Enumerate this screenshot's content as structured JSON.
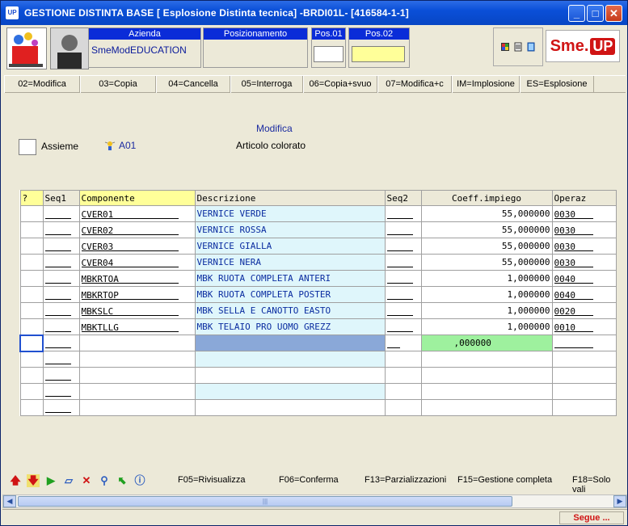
{
  "window": {
    "app_icon": "UP",
    "title": "GESTIONE DISTINTA BASE [ Esplosione Distinta tecnica] -BRDI01L- [416584-1-1]",
    "minimize_icon": "minimize-icon",
    "maximize_icon": "maximize-icon",
    "close_icon": "close-icon"
  },
  "header": {
    "azienda_label": "Azienda",
    "azienda_value": "SmeModEDUCATION",
    "posizionamento_label": "Posizionamento",
    "pos01_label": "Pos.01",
    "pos02_label": "Pos.02",
    "logo_text_1": "Sme.",
    "logo_text_2": "UP"
  },
  "function_keys": [
    {
      "label": "02=Modifica"
    },
    {
      "label": "03=Copia"
    },
    {
      "label": "04=Cancella"
    },
    {
      "label": "05=Interroga"
    },
    {
      "label": "06=Copia+svuo"
    },
    {
      "label": "07=Modifica+c"
    },
    {
      "label": "IM=Implosione"
    },
    {
      "label": "ES=Esplosione"
    }
  ],
  "form": {
    "mode": "Modifica",
    "assieme_label": "Assieme",
    "article_code": "A01",
    "article_desc": "Articolo colorato"
  },
  "grid": {
    "headers": {
      "q": "?",
      "seq1": "Seq1",
      "componente": "Componente",
      "descrizione": "Descrizione",
      "seq2": "Seq2",
      "coeff": "Coeff.impiego",
      "operaz": "Operaz"
    },
    "rows": [
      {
        "componente": "CVER01",
        "descrizione": "VERNICE VERDE",
        "coeff": "55,000000",
        "operaz": "0030"
      },
      {
        "componente": "CVER02",
        "descrizione": "VERNICE ROSSA",
        "coeff": "55,000000",
        "operaz": "0030"
      },
      {
        "componente": "CVER03",
        "descrizione": "VERNICE GIALLA",
        "coeff": "55,000000",
        "operaz": "0030"
      },
      {
        "componente": "CVER04",
        "descrizione": "VERNICE NERA",
        "coeff": "55,000000",
        "operaz": "0030"
      },
      {
        "componente": "MBKRTOA",
        "descrizione": "MBK RUOTA COMPLETA ANTERI",
        "coeff": "1,000000",
        "operaz": "0040"
      },
      {
        "componente": "MBKRTOP",
        "descrizione": "MBK RUOTA COMPLETA POSTER",
        "coeff": "1,000000",
        "operaz": "0040"
      },
      {
        "componente": "MBKSLC",
        "descrizione": "MBK SELLA E CANOTTO EASTO",
        "coeff": "1,000000",
        "operaz": "0020"
      },
      {
        "componente": "MBKTLLG",
        "descrizione": "MBK TELAIO PRO UOMO GREZZ",
        "coeff": "1,000000",
        "operaz": "0010"
      }
    ],
    "new_row_coeff": ",000000"
  },
  "bottom_toolbar": {
    "f05": "F05=Rivisualizza",
    "f06": "F06=Conferma",
    "f13": "F13=Parzializzazioni",
    "f15": "F15=Gestione completa",
    "f18": "F18=Solo vali"
  },
  "scrollbar": {
    "thumb_grip": "|||"
  },
  "status": {
    "segue": "Segue ..."
  }
}
